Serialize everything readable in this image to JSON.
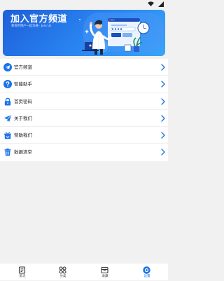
{
  "banner": {
    "title": "加入官方频道",
    "subtitle": "和悦色用户一起沟通 · Join Us"
  },
  "menu": {
    "items": [
      {
        "label": "官方频道",
        "icon": "telegram-official-icon"
      },
      {
        "label": "智能助手",
        "icon": "help-icon"
      },
      {
        "label": "首页密码",
        "icon": "lock-icon"
      },
      {
        "label": "关于我们",
        "icon": "paper-plane-icon"
      },
      {
        "label": "赞助我们",
        "icon": "gift-icon"
      },
      {
        "label": "数据清空",
        "icon": "trash-icon"
      }
    ]
  },
  "tabs": [
    {
      "label": "笔记",
      "icon": "note-icon",
      "active": false
    },
    {
      "label": "分类",
      "icon": "grid-icon",
      "active": false
    },
    {
      "label": "收藏",
      "icon": "archive-box-icon",
      "active": false
    },
    {
      "label": "设置",
      "icon": "settings-icon",
      "active": true
    }
  ],
  "colors": {
    "accent": "#1973e8",
    "banner_start": "#1d5fd8",
    "banner_end": "#3aa4f7",
    "background": "#f1f1f1"
  }
}
